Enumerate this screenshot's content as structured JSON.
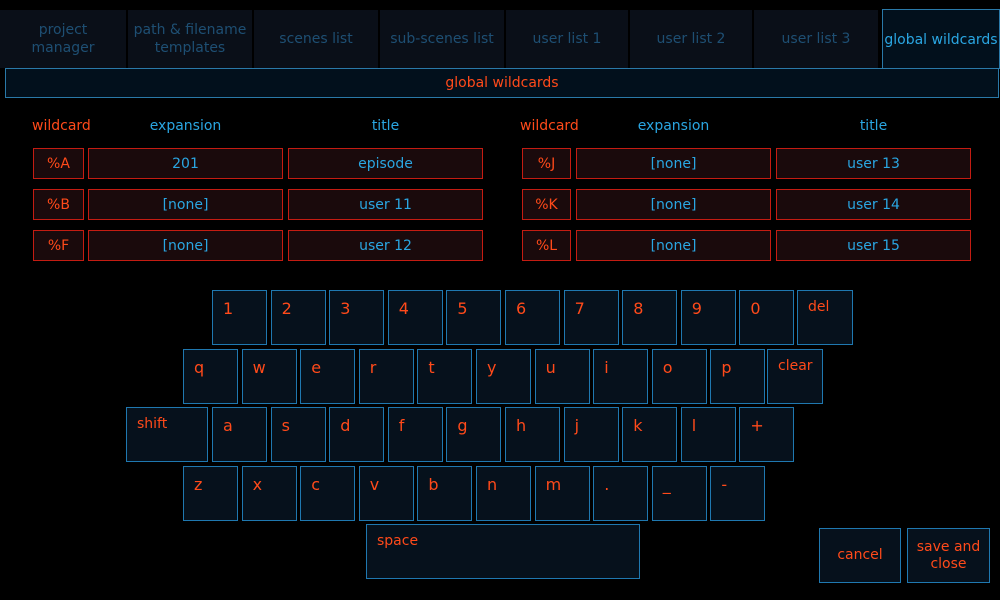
{
  "tabs": [
    {
      "label": "project\nmanager",
      "active": false
    },
    {
      "label": "path & filename\ntemplates",
      "active": false
    },
    {
      "label": "scenes list",
      "active": false
    },
    {
      "label": "sub-scenes list",
      "active": false
    },
    {
      "label": "user list 1",
      "active": false
    },
    {
      "label": "user list 2",
      "active": false
    },
    {
      "label": "user list 3",
      "active": false
    },
    {
      "label": "global wildcards",
      "active": true
    }
  ],
  "header": {
    "title": "global wildcards"
  },
  "columns": {
    "wildcard": "wildcard",
    "expansion": "expansion",
    "title": "title"
  },
  "wildcards_left": [
    {
      "key": "%A",
      "expansion": "201",
      "title": "episode"
    },
    {
      "key": "%B",
      "expansion": "[none]",
      "title": "user 11"
    },
    {
      "key": "%F",
      "expansion": "[none]",
      "title": "user 12"
    }
  ],
  "wildcards_right": [
    {
      "key": "%J",
      "expansion": "[none]",
      "title": "user 13"
    },
    {
      "key": "%K",
      "expansion": "[none]",
      "title": "user 14"
    },
    {
      "key": "%L",
      "expansion": "[none]",
      "title": "user 15"
    }
  ],
  "keyboard": {
    "row1": [
      "1",
      "2",
      "3",
      "4",
      "5",
      "6",
      "7",
      "8",
      "9",
      "0"
    ],
    "row2": [
      "q",
      "w",
      "e",
      "r",
      "t",
      "y",
      "u",
      "i",
      "o",
      "p"
    ],
    "row3": [
      "a",
      "s",
      "d",
      "f",
      "g",
      "h",
      "j",
      "k",
      "l",
      "+"
    ],
    "row4": [
      "z",
      "x",
      "c",
      "v",
      "b",
      "n",
      "m",
      ".",
      "_",
      "-"
    ],
    "del": "del",
    "clear": "clear",
    "shift": "shift",
    "space": "space"
  },
  "actions": {
    "cancel": "cancel",
    "save_close": "save and\nclose"
  },
  "colors": {
    "accent_orange": "#ff4a1a",
    "accent_blue": "#2aa6e2",
    "cell_border": "#c41c12",
    "key_border": "#1f78b0"
  }
}
